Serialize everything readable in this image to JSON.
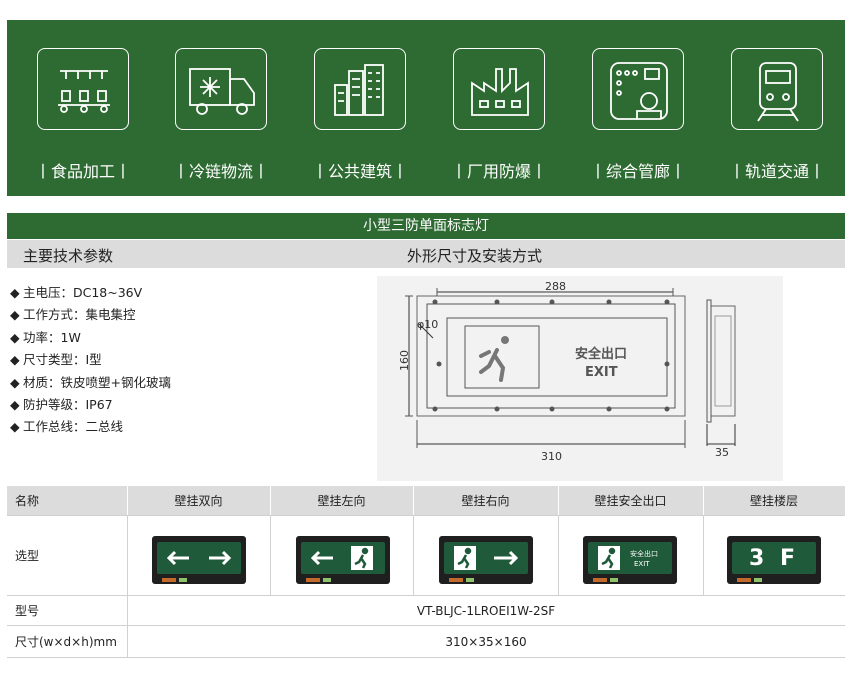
{
  "apps": [
    {
      "label": "丨食品加工丨",
      "icon": "food-processing-icon"
    },
    {
      "label": "丨冷链物流丨",
      "icon": "refrigerated-truck-icon"
    },
    {
      "label": "丨公共建筑丨",
      "icon": "public-building-icon"
    },
    {
      "label": "丨厂用防爆丨",
      "icon": "factory-icon"
    },
    {
      "label": "丨综合管廊丨",
      "icon": "utility-tunnel-icon"
    },
    {
      "label": "丨轨道交通丨",
      "icon": "train-icon"
    }
  ],
  "product_title": "小型三防单面标志灯",
  "specs_heading": "主要技术参数",
  "drawing_heading": "外形尺寸及安装方式",
  "specs": [
    "主电压：DC18~36V",
    "工作方式：集电集控",
    "功率：1W",
    "尺寸类型：Ⅰ型",
    "材质：铁皮喷塑+钢化玻璃",
    "防护等级：IP67",
    "工作总线：二总线"
  ],
  "drawing": {
    "inner_width": "288",
    "outer_width": "310",
    "height": "160",
    "hole": "φ10",
    "depth": "35",
    "sign_cn": "安全出口",
    "sign_en": "EXIT"
  },
  "table": {
    "headers": [
      "名称",
      "壁挂双向",
      "壁挂左向",
      "壁挂右向",
      "壁挂安全出口",
      "壁挂楼层"
    ],
    "selection_label": "选型",
    "floor_text": "3 F",
    "model_label": "型号",
    "model_value": "VT-BLJC-1LROEⅠ1W-2SF",
    "size_label": "尺寸(w×d×h)mm",
    "size_value": "310×35×160"
  },
  "colors": {
    "brand_green": "#2e6b32",
    "header_gray": "#dcdcdc"
  }
}
